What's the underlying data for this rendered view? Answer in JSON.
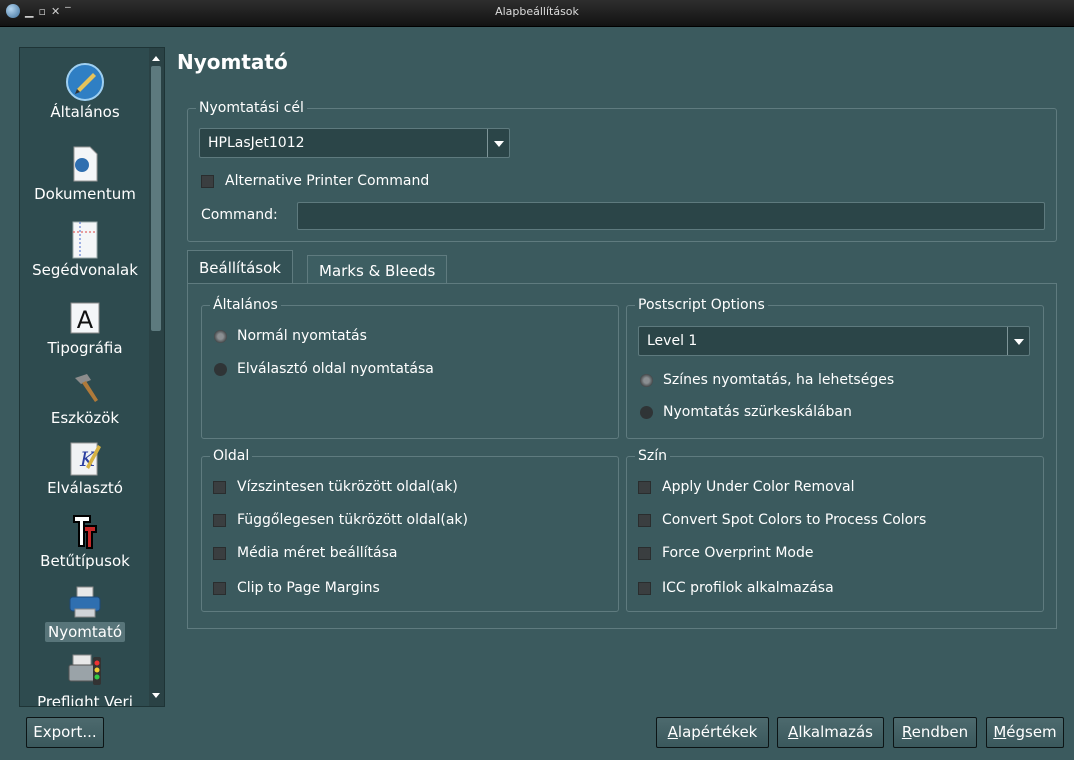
{
  "window": {
    "title": "Alapbeállítások"
  },
  "sidebar": {
    "items": [
      {
        "label": "Általános",
        "icon": "general-globe-icon"
      },
      {
        "label": "Dokumentum",
        "icon": "document-icon"
      },
      {
        "label": "Segédvonalak",
        "icon": "guides-icon"
      },
      {
        "label": "Tipográfia",
        "icon": "typography-icon"
      },
      {
        "label": "Eszközök",
        "icon": "tools-hammer-icon"
      },
      {
        "label": "Elválasztó",
        "icon": "hyphenator-icon"
      },
      {
        "label": "Betűtípusok",
        "icon": "fonts-icon"
      },
      {
        "label": "Nyomtató",
        "icon": "printer-icon",
        "selected": true
      },
      {
        "label": "Preflight Veri",
        "icon": "preflight-icon"
      }
    ]
  },
  "page": {
    "title": "Nyomtató"
  },
  "destination": {
    "legend": "Nyomtatási cél",
    "printer": "HPLasJet1012",
    "alt_command_label": "Alternative Printer Command",
    "command_label": "Command:",
    "command_value": ""
  },
  "tabs": [
    {
      "label": "Beállítások",
      "active": true
    },
    {
      "label": "Marks & Bleeds",
      "active": false
    }
  ],
  "general": {
    "legend": "Általános",
    "options": [
      {
        "label": "Normál nyomtatás",
        "selected": true
      },
      {
        "label": "Elválasztó oldal nyomtatása",
        "selected": false
      }
    ]
  },
  "postscript": {
    "legend": "Postscript Options",
    "level": "Level 1",
    "options": [
      {
        "label": "Színes nyomtatás, ha lehetséges",
        "selected": true
      },
      {
        "label": "Nyomtatás szürkeskálában",
        "selected": false
      }
    ]
  },
  "page_opts": {
    "legend": "Oldal",
    "checks": [
      "Vízszintesen tükrözött oldal(ak)",
      "Függőlegesen tükrözött oldal(ak)",
      "Média méret beállítása",
      "Clip to Page Margins"
    ]
  },
  "color": {
    "legend": "Szín",
    "checks": [
      "Apply Under Color Removal",
      "Convert Spot Colors to Process Colors",
      "Force Overprint Mode",
      "ICC profilok alkalmazása"
    ]
  },
  "buttons": {
    "export": "Export...",
    "defaults": {
      "accel": "A",
      "rest": "lapértékek"
    },
    "apply": {
      "accel": "A",
      "rest": "lkalmazás"
    },
    "ok": {
      "accel": "R",
      "rest": "endben"
    },
    "cancel": {
      "accel": "M",
      "rest": "égsem"
    }
  },
  "colors": {
    "background": "#3b5a5e",
    "sidebar": "#2e4b4f",
    "titlebar": "#1c1c1c"
  }
}
